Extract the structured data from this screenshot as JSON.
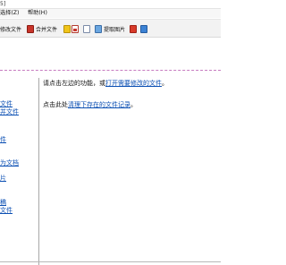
{
  "window": {
    "title_fragment": "5]"
  },
  "menu": {
    "items": [
      {
        "label": "选择(Z)"
      },
      {
        "label": "帮助(H)"
      }
    ]
  },
  "toolbar": {
    "items": [
      {
        "label": "修改文件",
        "icon": "edit-file-icon"
      },
      {
        "label": "合并文件",
        "icon": "merge-files-icon"
      },
      {
        "label": "",
        "icon": "yellow-bar-icon"
      },
      {
        "label": "",
        "icon": "pdf-icon"
      },
      {
        "label": "",
        "icon": "document-icon"
      },
      {
        "label": "提取图片",
        "icon": "extract-images-icon"
      },
      {
        "label": "",
        "icon": "image-icon"
      },
      {
        "label": "",
        "icon": "blue-document-icon"
      }
    ]
  },
  "left_panel": {
    "links": [
      {
        "label": "文件"
      },
      {
        "label": "并文件"
      },
      {
        "label": "件"
      },
      {
        "label": "为文档"
      },
      {
        "label": "片"
      },
      {
        "label": "稿"
      },
      {
        "label": "文件"
      }
    ]
  },
  "content": {
    "line1_prefix": "请点击左边的功能，或",
    "line1_link": "打开需要修改的文件",
    "line1_suffix": "。",
    "line2_prefix": "点击此处",
    "line2_link": "清理下存在的文件记录",
    "line2_suffix": "。"
  }
}
